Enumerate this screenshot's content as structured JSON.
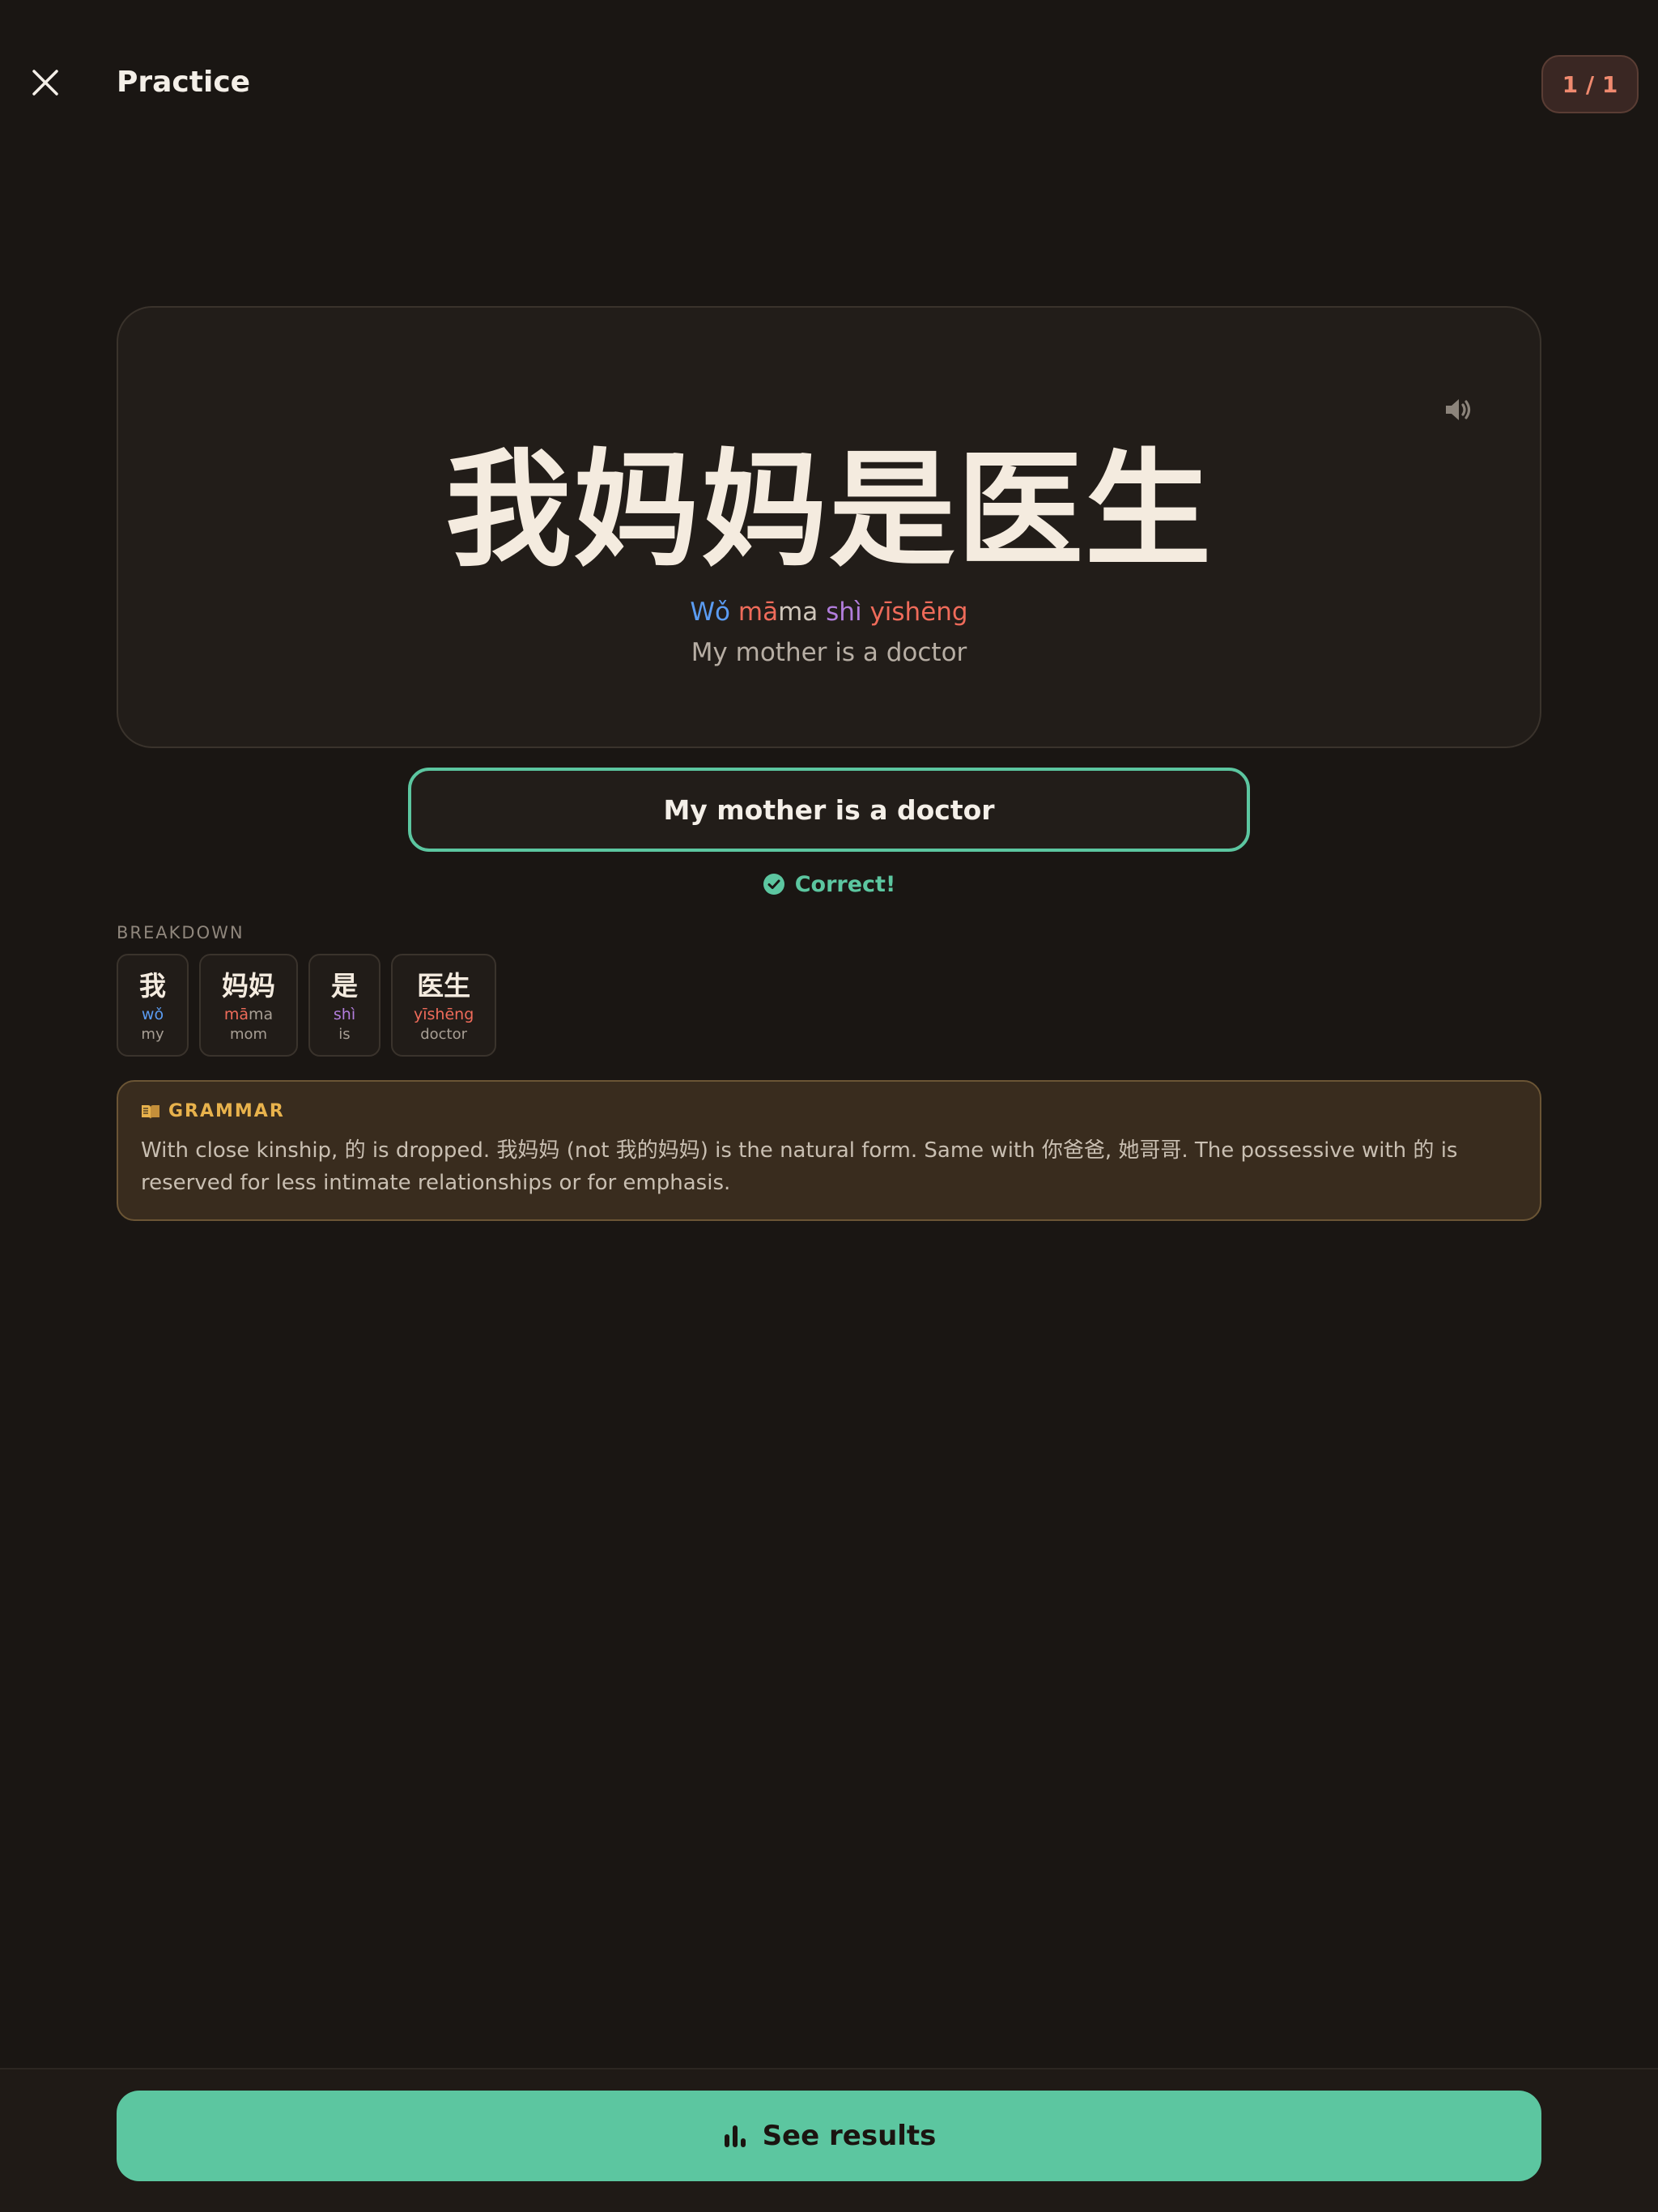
{
  "header": {
    "title": "Practice",
    "progress": "1 / 1"
  },
  "sentence": {
    "hanzi": "我妈妈是医生",
    "pinyin": [
      {
        "text": "Wǒ",
        "color": "#5b9cf2"
      },
      {
        "text": " ",
        "color": "#cfc6bb"
      },
      {
        "text": "mā",
        "color": "#ef6b5a"
      },
      {
        "text": "ma",
        "color": "#cfc6bb"
      },
      {
        "text": " ",
        "color": "#cfc6bb"
      },
      {
        "text": "shì",
        "color": "#b27ddc"
      },
      {
        "text": " ",
        "color": "#cfc6bb"
      },
      {
        "text": "yīshēng",
        "color": "#ef6b5a"
      }
    ],
    "translation": "My mother is a doctor"
  },
  "answer": {
    "value": "My mother is a doctor"
  },
  "feedback": {
    "text": "Correct!",
    "color": "#5cc6a0"
  },
  "breakdown": {
    "label": "BREAKDOWN",
    "items": [
      {
        "hanzi": "我",
        "pinyin": [
          {
            "text": "wǒ",
            "color": "#5b9cf2"
          }
        ],
        "gloss": "my"
      },
      {
        "hanzi": "妈妈",
        "pinyin": [
          {
            "text": "mā",
            "color": "#ef6b5a"
          },
          {
            "text": "ma",
            "color": "#a79e94"
          }
        ],
        "gloss": "mom"
      },
      {
        "hanzi": "是",
        "pinyin": [
          {
            "text": "shì",
            "color": "#b27ddc"
          }
        ],
        "gloss": "is"
      },
      {
        "hanzi": "医生",
        "pinyin": [
          {
            "text": "yīshēng",
            "color": "#ef6b5a"
          }
        ],
        "gloss": "doctor"
      }
    ]
  },
  "grammar": {
    "label": "GRAMMAR",
    "text": "With close kinship, 的 is dropped. 我妈妈 (not 我的妈妈) is the natural form. Same with 你爸爸, 她哥哥. The possessive with 的 is reserved for less intimate relationships or for emphasis."
  },
  "footer": {
    "button_label": "See results"
  },
  "icons": {
    "close": "close-icon",
    "speaker": "speaker-icon",
    "check": "check-circle-icon",
    "book": "book-icon",
    "chart": "bar-chart-icon"
  },
  "colors": {
    "accent": "#5cc6a0",
    "background": "#1a1613",
    "badge_text": "#f08a6f",
    "grammar_label": "#e8b24c"
  }
}
